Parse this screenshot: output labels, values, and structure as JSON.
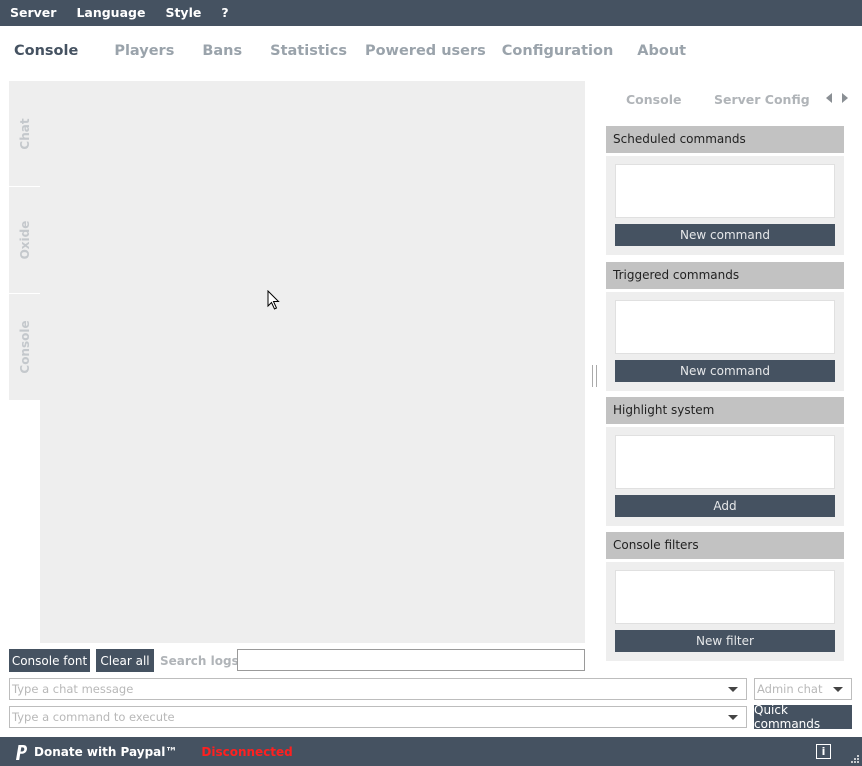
{
  "menu": {
    "items": [
      "Server",
      "Language",
      "Style",
      "?"
    ]
  },
  "main_tabs": [
    "Console",
    "Players",
    "Bans",
    "Statistics",
    "Powered users",
    "Configuration",
    "About"
  ],
  "side_tabs": [
    "Chat",
    "Oxide",
    "Console"
  ],
  "toolbar": {
    "console_font": "Console font",
    "clear_all": "Clear all",
    "search_label": "Search logs :",
    "search_value": ""
  },
  "chat": {
    "placeholder": "Type a chat message",
    "channel": "Admin chat"
  },
  "command": {
    "placeholder": "Type a command to execute",
    "quick_label": "Quick commands"
  },
  "right_panel": {
    "tabs": [
      "Console",
      "Server Config"
    ],
    "sections": [
      {
        "title": "Scheduled commands",
        "button": "New command"
      },
      {
        "title": "Triggered commands",
        "button": "New command"
      },
      {
        "title": "Highlight system",
        "button": "Add"
      },
      {
        "title": "Console filters",
        "button": "New filter"
      }
    ]
  },
  "status": {
    "donate": "Donate with Paypal™",
    "connection": "Disconnected",
    "connection_color": "#ff2020"
  },
  "colors": {
    "accent": "#455261",
    "panel_bg": "#eeeeee",
    "header_bg": "#c2c2c2"
  },
  "icons": [
    "paypal-icon",
    "info-icon",
    "mouse-cursor-icon",
    "resize-grip-icon",
    "chevron-left-icon",
    "chevron-right-icon",
    "dropdown-arrow-icon"
  ]
}
